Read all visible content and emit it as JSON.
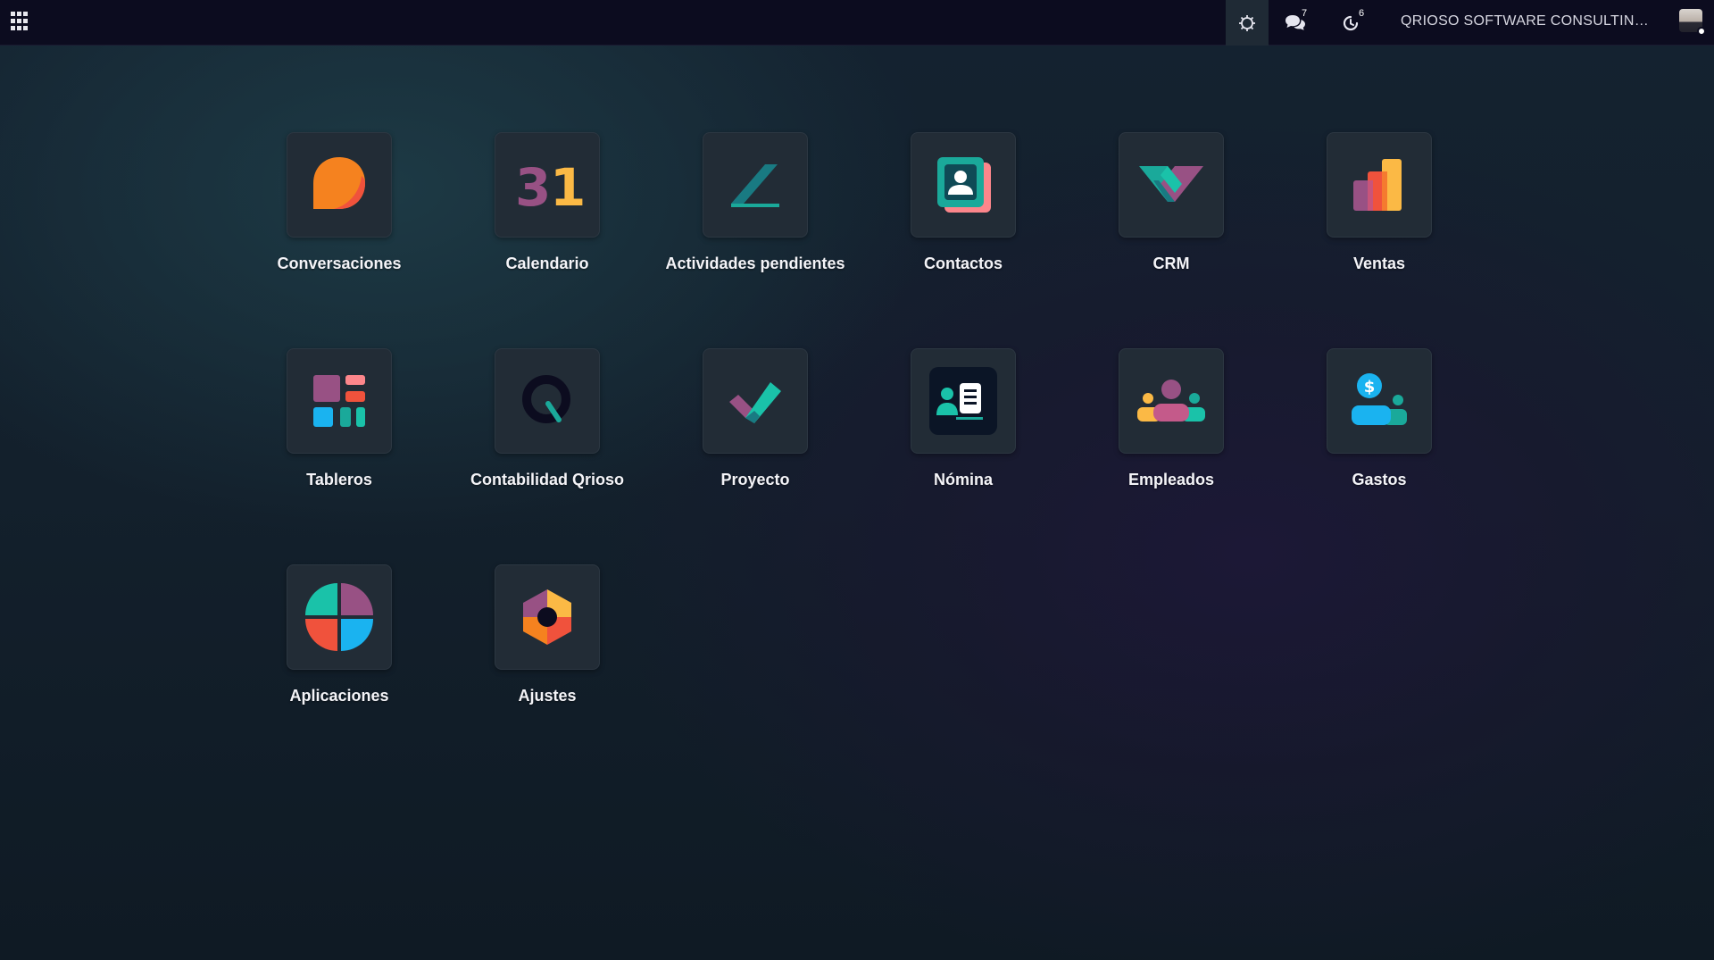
{
  "navbar": {
    "apps_icon": "grid-icon",
    "debug_icon": "bug-icon",
    "messages_icon": "chat-icon",
    "messages_count": "7",
    "activities_icon": "clock-icon",
    "activities_count": "6",
    "company": "QRIOSO SOFTWARE CONSULTIN…",
    "avatar": "user-avatar"
  },
  "apps": [
    {
      "label": "Conversaciones",
      "icon": "discuss-icon"
    },
    {
      "label": "Calendario",
      "icon": "calendar-icon",
      "icon_text": "31"
    },
    {
      "label": "Actividades pendientes",
      "icon": "todo-icon"
    },
    {
      "label": "Contactos",
      "icon": "contacts-icon"
    },
    {
      "label": "CRM",
      "icon": "crm-handshake-icon"
    },
    {
      "label": "Ventas",
      "icon": "sales-chart-icon"
    },
    {
      "label": "Tableros",
      "icon": "dashboards-icon"
    },
    {
      "label": "Contabilidad Qrioso",
      "icon": "accounting-q-icon"
    },
    {
      "label": "Proyecto",
      "icon": "project-check-icon"
    },
    {
      "label": "Nómina",
      "icon": "payroll-icon"
    },
    {
      "label": "Empleados",
      "icon": "employees-icon"
    },
    {
      "label": "Gastos",
      "icon": "expenses-icon",
      "icon_text": "$"
    },
    {
      "label": "Aplicaciones",
      "icon": "apps-icon"
    },
    {
      "label": "Ajustes",
      "icon": "settings-icon"
    }
  ],
  "colors": {
    "navbar_bg": "#0c0c1f",
    "tile_bg": "#222c36",
    "orange": "#f5821f",
    "teal": "#1aa99a",
    "purple": "#985184",
    "coral": "#fc868b",
    "blue": "#1ab3f0",
    "yellow": "#fbb945"
  }
}
